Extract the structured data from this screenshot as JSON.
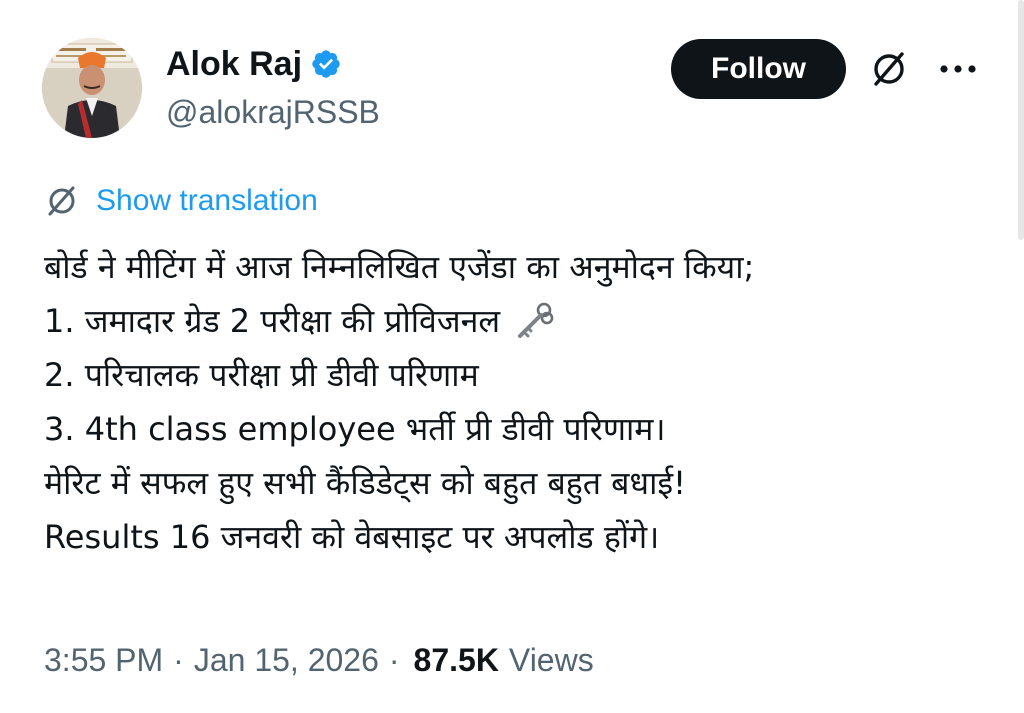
{
  "author": {
    "display_name": "Alok Raj",
    "handle": "@alokrajRSSB",
    "verified": true,
    "avatar_icon": "profile-photo"
  },
  "actions": {
    "follow_label": "Follow",
    "translate_icon": "translate-icon",
    "more_icon": "more-dots-icon"
  },
  "translation": {
    "label": "Show translation"
  },
  "tweet": {
    "lines": [
      "बोर्ड ने मीटिंग में आज निम्नलिखित  एजेंडा का अनुमोदन किया;",
      "1. जमादार ग्रेड 2 परीक्षा की प्रोविजनल",
      "2. परिचालक परीक्षा प्री डीवी परिणाम",
      "3. 4th class employee भर्ती प्री डीवी परिणाम।",
      "मेरिट में सफल हुए सभी कैंडिडेट्स को बहुत बहुत बधाई!",
      "Results 16 जनवरी को वेबसाइट पर अपलोड होंगे।"
    ],
    "emoji_after_line_2": "key-icon"
  },
  "meta": {
    "time": "3:55 PM",
    "date": "Jan 15, 2026",
    "views_count": "87.5K",
    "views_label": "Views",
    "separator": "·"
  },
  "colors": {
    "text_primary": "#0f1419",
    "text_secondary": "#536471",
    "link_blue": "#1d9bf0",
    "follow_bg": "#0f1419",
    "verified_blue": "#1d9bf0"
  }
}
